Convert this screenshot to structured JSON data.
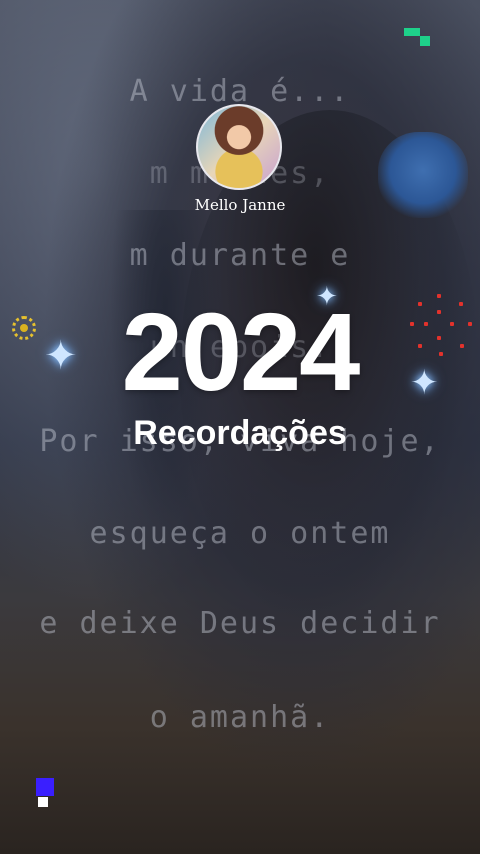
{
  "profile": {
    "name": "Mello Janne"
  },
  "title": {
    "year": "2024",
    "subtitle": "Recordações"
  },
  "lyrics": [
    "A vida é...",
    "m    mentes,",
    "m durante e",
    "un     epois.",
    "Por isso, viva hoje,",
    "esqueça o ontem",
    "e deixe Deus decidir",
    "o amanhã."
  ],
  "colors": {
    "accent_green": "#1ed18a",
    "accent_blue": "#3a1fff",
    "sun_yellow": "#e6c12e",
    "dots_red": "#e2322c"
  }
}
